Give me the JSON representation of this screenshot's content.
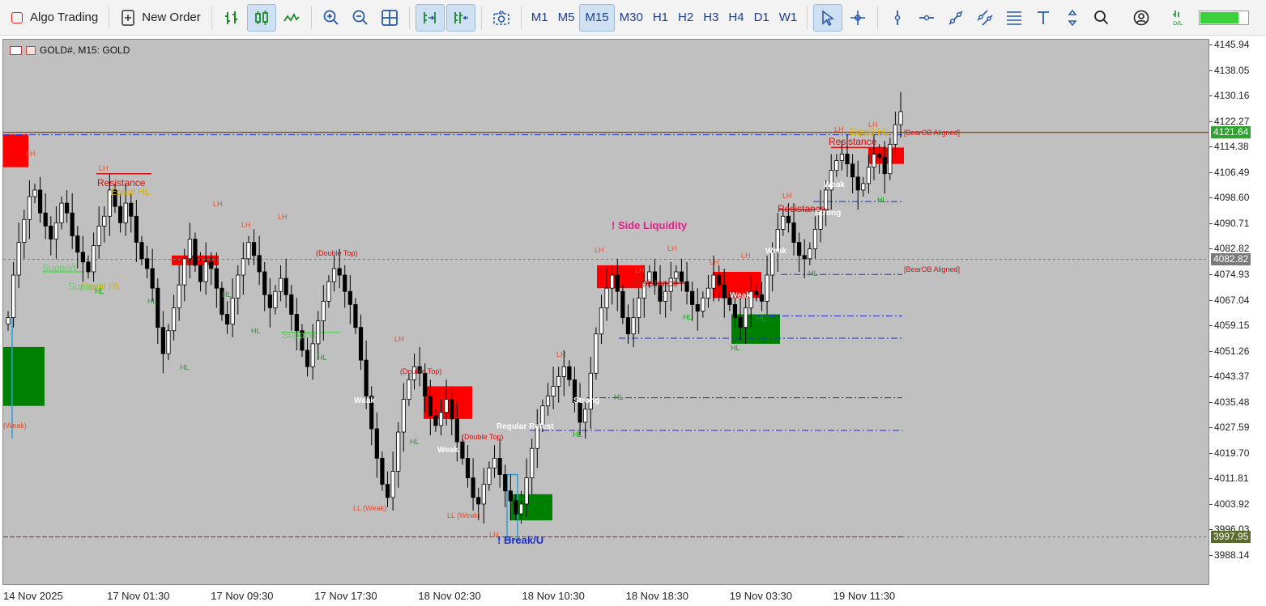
{
  "toolbar": {
    "algo_trading": "Algo Trading",
    "new_order": "New Order",
    "timeframes": [
      "M1",
      "M5",
      "M15",
      "M30",
      "H1",
      "H4",
      "D1",
      "W1"
    ],
    "timeframes_full": [
      "M1",
      "M5",
      "M15",
      "M30",
      "H1",
      "H2",
      "H3",
      "H4",
      "D1",
      "W1"
    ],
    "active_timeframe": "M15"
  },
  "chart": {
    "title": "GOLD#, M15:  GOLD",
    "current_price": "4121.64",
    "mid_price": "4082.82",
    "low_price": "3997.95",
    "y_ticks": [
      "4145.94",
      "4138.05",
      "4130.16",
      "4122.27",
      "4114.38",
      "4106.49",
      "4098.60",
      "4090.71",
      "4082.82",
      "4074.93",
      "4067.04",
      "4059.15",
      "4051.26",
      "4043.37",
      "4035.48",
      "4027.59",
      "4019.70",
      "4011.81",
      "4003.92",
      "3996.03",
      "3988.14"
    ],
    "x_ticks": [
      "14 Nov 2025",
      "17 Nov 01:30",
      "17 Nov 09:30",
      "17 Nov 17:30",
      "18 Nov 02:30",
      "18 Nov 10:30",
      "18 Nov 18:30",
      "19 Nov 03:30",
      "19 Nov 11:30"
    ],
    "annotations": {
      "side_liquidity": "! Side Liquidity",
      "break": "! Break/U",
      "bear_ob_1": "[BearOB Aligned]",
      "bear_ob_2": "[BearOB Aligned]",
      "resistance": "Resistance",
      "equal_hl": "Equal HL",
      "support": "Support",
      "double_top": "(Double Top)",
      "weak": "Weak",
      "strong": "Strong",
      "retest": "Regular Retest",
      "lh": "LH",
      "hl": "HL",
      "ll_weak": "LL (Weak)",
      "weak_paren": "(Weak)"
    },
    "colors": {
      "background": "#c0c0c0",
      "bull_block": "#008000",
      "bear_block": "#ff0000",
      "level_line": "#1f2fc8",
      "current_price": "#2fa32f",
      "candle": "#000000"
    }
  },
  "chart_data": {
    "type": "candlestick",
    "title": "GOLD#, M15:  GOLD",
    "ylim": [
      3983,
      4150
    ],
    "x_ticks": [
      "14 Nov 2025",
      "17 Nov 01:30",
      "17 Nov 09:30",
      "17 Nov 17:30",
      "18 Nov 02:30",
      "18 Nov 10:30",
      "18 Nov 18:30",
      "19 Nov 03:30",
      "19 Nov 11:30"
    ],
    "series": [
      {
        "values": [
          4065,
          4078,
          4088,
          4095,
          4102,
          4104,
          4097,
          4093,
          4089,
          4094,
          4100,
          4097,
          4090,
          4085,
          4082,
          4079,
          4087,
          4093,
          4096,
          4104,
          4099,
          4094,
          4100,
          4096,
          4088,
          4083,
          4080,
          4074,
          4062,
          4054,
          4061,
          4068,
          4075,
          4083,
          4089,
          4081,
          4076,
          4082,
          4080,
          4074,
          4066,
          4063,
          4071,
          4078,
          4083,
          4088,
          4084,
          4079,
          4072,
          4068,
          4073,
          4077,
          4072,
          4066,
          4061,
          4055,
          4050,
          4057,
          4064,
          4070,
          4076,
          4080,
          4078,
          4073,
          4069,
          4062,
          4052,
          4041,
          4031,
          4022,
          4014,
          4010,
          4018,
          4030,
          4040,
          4046,
          4050,
          4048,
          4041,
          4035,
          4032,
          4036,
          4040,
          4034,
          4027,
          4022,
          4016,
          4010,
          4008,
          4014,
          4019,
          4022,
          4017,
          4012,
          4009,
          4005,
          4008,
          4016,
          4025,
          4032,
          4038,
          4041,
          4044,
          4047,
          4050,
          4046,
          4039,
          4033,
          4037,
          4048,
          4060,
          4068,
          4074,
          4078,
          4073,
          4065,
          4060,
          4065,
          4071,
          4076,
          4079,
          4075,
          4070,
          4073,
          4077,
          4079,
          4076,
          4073,
          4069,
          4067,
          4071,
          4074,
          4078,
          4075,
          4071,
          4069,
          4065,
          4062,
          4068,
          4073,
          4072,
          4070,
          4078,
          4085,
          4092,
          4096,
          4094,
          4088,
          4084,
          4083,
          4086,
          4092,
          4098,
          4104,
          4110,
          4113,
          4115,
          4112,
          4108,
          4104,
          4106,
          4111,
          4115,
          4114,
          4109,
          4118,
          4124,
          4128
        ]
      }
    ],
    "horizontal_levels": [
      {
        "price": 4121.64,
        "label": "4121.64"
      },
      {
        "price": 4082.82,
        "label": "4082.82"
      },
      {
        "price": 3997.95,
        "label": "3997.95"
      }
    ],
    "labels": [
      "! Side Liquidity",
      "! Break/U",
      "[BearOB Aligned]",
      "[BearOB Aligned]"
    ]
  }
}
